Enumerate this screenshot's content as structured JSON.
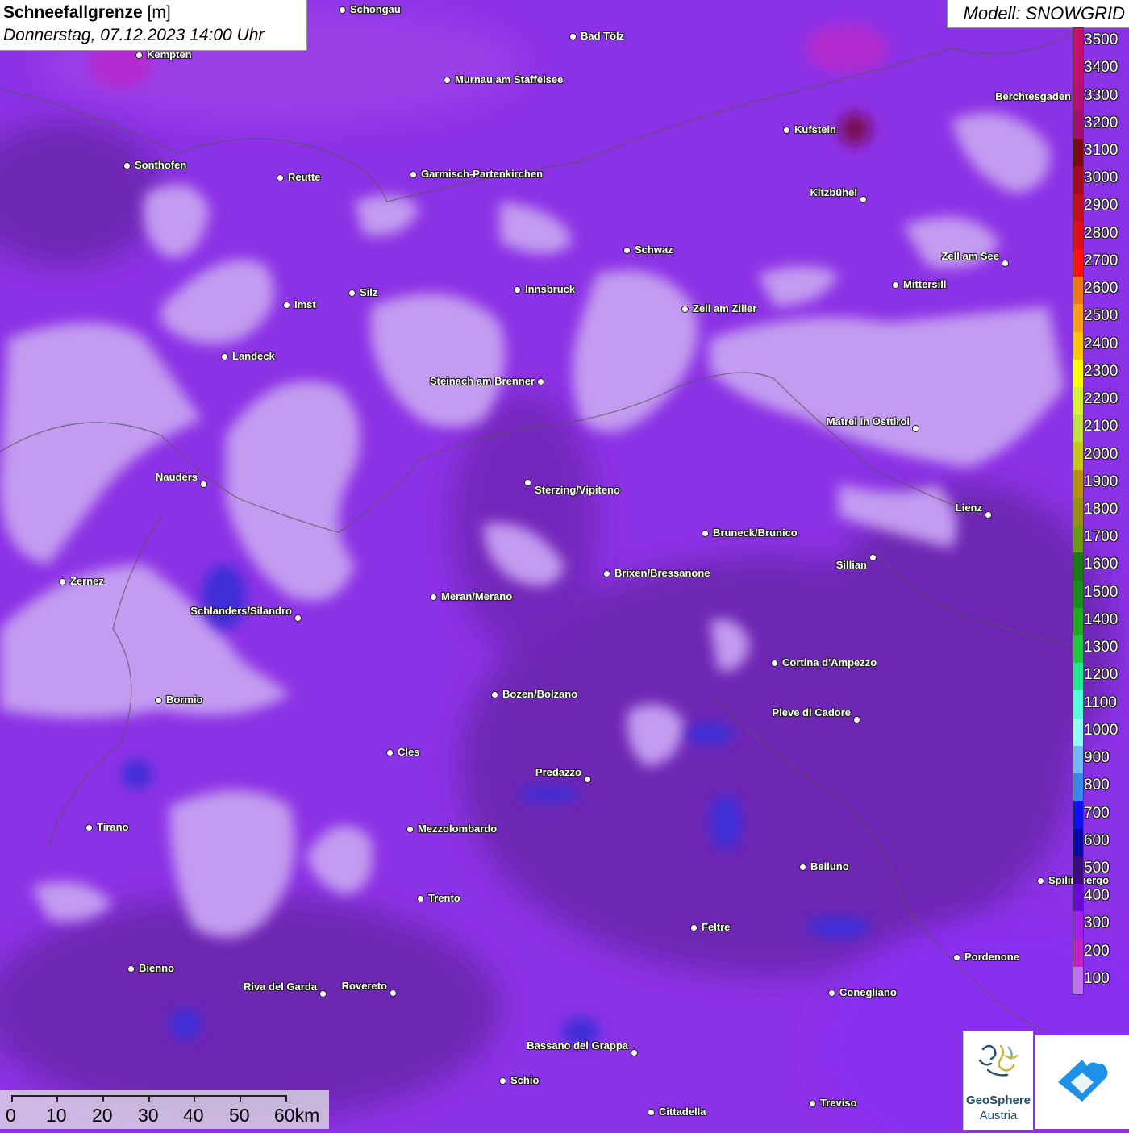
{
  "header": {
    "title": "Schneefallgrenze",
    "unit": "[m]",
    "subtitle": "Donnerstag, 07.12.2023 14:00 Uhr",
    "model": "Modell: SNOWGRID"
  },
  "legend": {
    "levels": [
      "3500",
      "3400",
      "3300",
      "3200",
      "3100",
      "3000",
      "2900",
      "2800",
      "2700",
      "2600",
      "2500",
      "2400",
      "2300",
      "2200",
      "2100",
      "2000",
      "1900",
      "1800",
      "1700",
      "1600",
      "1500",
      "1400",
      "1300",
      "1200",
      "1100",
      "1000",
      "900",
      "800",
      "700",
      "600",
      "500",
      "400",
      "300",
      "200",
      "100"
    ],
    "colors": [
      "#c8106a",
      "#c21070",
      "#b40f72",
      "#a0106e",
      "#7a0c10",
      "#a4081a",
      "#c50d1e",
      "#e20d1b",
      "#ff1010",
      "#f07818",
      "#ff9c18",
      "#ffc400",
      "#ffff00",
      "#d8f23a",
      "#c0e040",
      "#c8c418",
      "#b89010",
      "#9a9010",
      "#6a9a10",
      "#1a7a18",
      "#1a8e1a",
      "#20a820",
      "#20c840",
      "#20e890",
      "#50ffd8",
      "#90fcfc",
      "#70b8f8",
      "#3a88ee",
      "#1010f0",
      "#0a0aa8",
      "#3a0a80",
      "#6a0ad8",
      "#a020e8",
      "#c022c0",
      "#c070f0"
    ]
  },
  "cities": [
    {
      "name": "Schongau",
      "side": "r"
    },
    {
      "name": "Bad Tölz",
      "side": "r"
    },
    {
      "name": "Kempten",
      "side": "r"
    },
    {
      "name": "Murnau am Staffelsee",
      "side": "r"
    },
    {
      "name": "Kufstein",
      "side": "r"
    },
    {
      "name": "Berchtesgaden",
      "side": "l"
    },
    {
      "name": "Sonthofen",
      "side": "r"
    },
    {
      "name": "Reutte",
      "side": "r"
    },
    {
      "name": "Garmisch-Partenkirchen",
      "side": "r"
    },
    {
      "name": "Kitzbühel",
      "side": "l"
    },
    {
      "name": "Schwaz",
      "side": "r"
    },
    {
      "name": "Zell am See",
      "side": "l"
    },
    {
      "name": "Mittersill",
      "side": "r"
    },
    {
      "name": "Innsbruck",
      "side": "r"
    },
    {
      "name": "Silz",
      "side": "r"
    },
    {
      "name": "Imst",
      "side": "r"
    },
    {
      "name": "Zell am Ziller",
      "side": "r"
    },
    {
      "name": "Landeck",
      "side": "r"
    },
    {
      "name": "Steinach am Brenner",
      "side": "l"
    },
    {
      "name": "Matrei in Osttirol",
      "side": "l"
    },
    {
      "name": "Nauders",
      "side": "l"
    },
    {
      "name": "Sterzing/Vipiteno",
      "side": "r"
    },
    {
      "name": "Lienz",
      "side": "l"
    },
    {
      "name": "Bruneck/Brunico",
      "side": "r"
    },
    {
      "name": "Sillian",
      "side": "l"
    },
    {
      "name": "Zernez",
      "side": "r"
    },
    {
      "name": "Brixen/Bressanone",
      "side": "r"
    },
    {
      "name": "Meran/Merano",
      "side": "r"
    },
    {
      "name": "Schlanders/Silandro",
      "side": "l"
    },
    {
      "name": "Cortina d'Ampezzo",
      "side": "r"
    },
    {
      "name": "Bozen/Bolzano",
      "side": "r"
    },
    {
      "name": "Bormio",
      "side": "r"
    },
    {
      "name": "Pieve di Cadore",
      "side": "l"
    },
    {
      "name": "Cles",
      "side": "r"
    },
    {
      "name": "Predazzo",
      "side": "l"
    },
    {
      "name": "Tirano",
      "side": "r"
    },
    {
      "name": "Mezzolombardo",
      "side": "r"
    },
    {
      "name": "Belluno",
      "side": "r"
    },
    {
      "name": "Spilimbergo",
      "side": "r"
    },
    {
      "name": "Trento",
      "side": "r"
    },
    {
      "name": "Feltre",
      "side": "r"
    },
    {
      "name": "Pordenone",
      "side": "r"
    },
    {
      "name": "Bienno",
      "side": "r"
    },
    {
      "name": "Riva del Garda",
      "side": "l"
    },
    {
      "name": "Rovereto",
      "side": "l"
    },
    {
      "name": "Conegliano",
      "side": "r"
    },
    {
      "name": "Bassano del Grappa",
      "side": "l"
    },
    {
      "name": "Schio",
      "side": "r"
    },
    {
      "name": "Treviso",
      "side": "r"
    },
    {
      "name": "Cittadella",
      "side": "r"
    }
  ],
  "scale": {
    "labels": [
      "0",
      "10",
      "20",
      "30",
      "40",
      "50",
      "60km"
    ]
  },
  "logos": {
    "geosphere_line1": "GeoSphere",
    "geosphere_line2": "Austria"
  },
  "colors": {
    "light": "#c49af0",
    "mid": "#9a3cf0",
    "dark": "#7a2cc0",
    "darker": "#6a22a8",
    "blue": "#3a30e0",
    "magenta": "#b22ccf"
  }
}
